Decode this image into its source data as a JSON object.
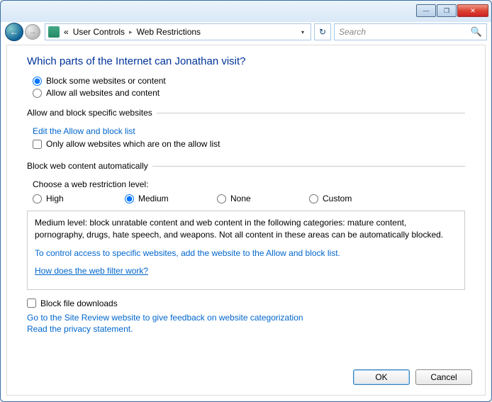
{
  "titlebar": {
    "min": "—",
    "max": "❐",
    "close": "✕"
  },
  "nav": {
    "back": "←",
    "fwd": "→",
    "overflow": "«",
    "crumb1": "User Controls",
    "crumb2": "Web Restrictions",
    "sep": "▸",
    "drop": "▾",
    "refresh": "↻",
    "search_placeholder": "Search",
    "mag": "🔍"
  },
  "page": {
    "heading": "Which parts of the Internet can Jonathan visit?",
    "opt_block": "Block some websites or content",
    "opt_allow": "Allow all websites and content"
  },
  "specific": {
    "legend": "Allow and block specific websites",
    "edit_link": "Edit the Allow and block list",
    "only_allow": "Only allow websites which are on the allow list"
  },
  "auto": {
    "legend": "Block web content automatically",
    "choose": "Choose a web restriction level:",
    "levels": {
      "high": "High",
      "medium": "Medium",
      "none": "None",
      "custom": "Custom"
    },
    "desc": "Medium level:  block unratable content and web content in the following categories:  mature content, pornography, drugs, hate speech, and weapons.  Not all content in these areas can be automatically blocked.",
    "control_link": "To control access to specific websites, add the website to the Allow and block list.",
    "how_link": "How does the web filter work?"
  },
  "footer": {
    "block_downloads": "Block file downloads",
    "feedback_link": "Go to the Site Review website to give feedback on website categorization",
    "privacy_link": "Read the privacy statement."
  },
  "buttons": {
    "ok": "OK",
    "cancel": "Cancel"
  }
}
